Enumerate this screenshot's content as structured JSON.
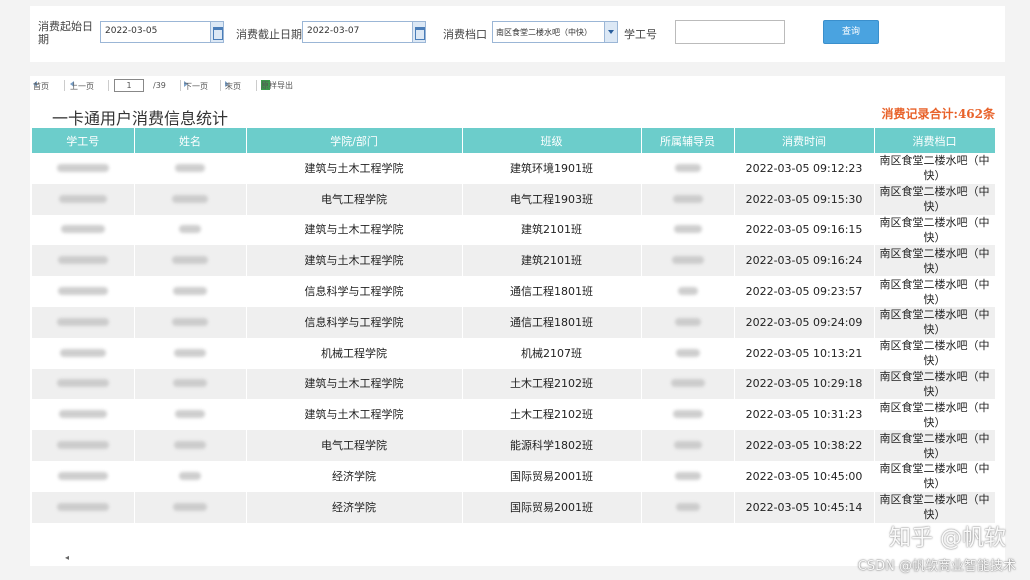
{
  "filter": {
    "start_label": "消费起始日期",
    "start_value": "2022-03-05",
    "end_label": "消费截止日期",
    "end_value": "2022-03-07",
    "location_label": "消费档口",
    "location_value": "南区食堂二楼水吧（中快）",
    "student_id_label": "学工号",
    "student_id_value": "",
    "query_label": "查询"
  },
  "pager": {
    "first": "首页",
    "prev": "上一页",
    "current_page": "1",
    "total_pages": "/39",
    "next": "下一页",
    "last": "末页",
    "export": "原样导出"
  },
  "report": {
    "title": "一卡通用户消费信息统计",
    "total": "消费记录合计:462条"
  },
  "table": {
    "headers": [
      "学工号",
      "姓名",
      "学院/部门",
      "班级",
      "所属辅导员",
      "消费时间",
      "消费档口"
    ],
    "rows": [
      {
        "college": "建筑与土木工程学院",
        "class": "建筑环境1901班",
        "time": "2022-03-05 09:12:23",
        "location": "南区食堂二楼水吧（中快）"
      },
      {
        "college": "电气工程学院",
        "class": "电气工程1903班",
        "time": "2022-03-05 09:15:30",
        "location": "南区食堂二楼水吧（中快）"
      },
      {
        "college": "建筑与土木工程学院",
        "class": "建筑2101班",
        "time": "2022-03-05 09:16:15",
        "location": "南区食堂二楼水吧（中快）"
      },
      {
        "college": "建筑与土木工程学院",
        "class": "建筑2101班",
        "time": "2022-03-05 09:16:24",
        "location": "南区食堂二楼水吧（中快）"
      },
      {
        "college": "信息科学与工程学院",
        "class": "通信工程1801班",
        "time": "2022-03-05 09:23:57",
        "location": "南区食堂二楼水吧（中快）"
      },
      {
        "college": "信息科学与工程学院",
        "class": "通信工程1801班",
        "time": "2022-03-05 09:24:09",
        "location": "南区食堂二楼水吧（中快）"
      },
      {
        "college": "机械工程学院",
        "class": "机械2107班",
        "time": "2022-03-05 10:13:21",
        "location": "南区食堂二楼水吧（中快）"
      },
      {
        "college": "建筑与土木工程学院",
        "class": "土木工程2102班",
        "time": "2022-03-05 10:29:18",
        "location": "南区食堂二楼水吧（中快）"
      },
      {
        "college": "建筑与土木工程学院",
        "class": "土木工程2102班",
        "time": "2022-03-05 10:31:23",
        "location": "南区食堂二楼水吧（中快）"
      },
      {
        "college": "电气工程学院",
        "class": "能源科学1802班",
        "time": "2022-03-05 10:38:22",
        "location": "南区食堂二楼水吧（中快）"
      },
      {
        "college": "经济学院",
        "class": "国际贸易2001班",
        "time": "2022-03-05 10:45:00",
        "location": "南区食堂二楼水吧（中快）"
      },
      {
        "college": "经济学院",
        "class": "国际贸易2001班",
        "time": "2022-03-05 10:45:14",
        "location": "南区食堂二楼水吧（中快）"
      }
    ]
  },
  "watermark": {
    "line1": "知乎 @帆软",
    "line2": "CSDN @帆软商业智能技术"
  },
  "colors": {
    "header_teal": "#6ccdcb",
    "total_orange": "#e8622a",
    "query_blue": "#4aa3e0"
  }
}
